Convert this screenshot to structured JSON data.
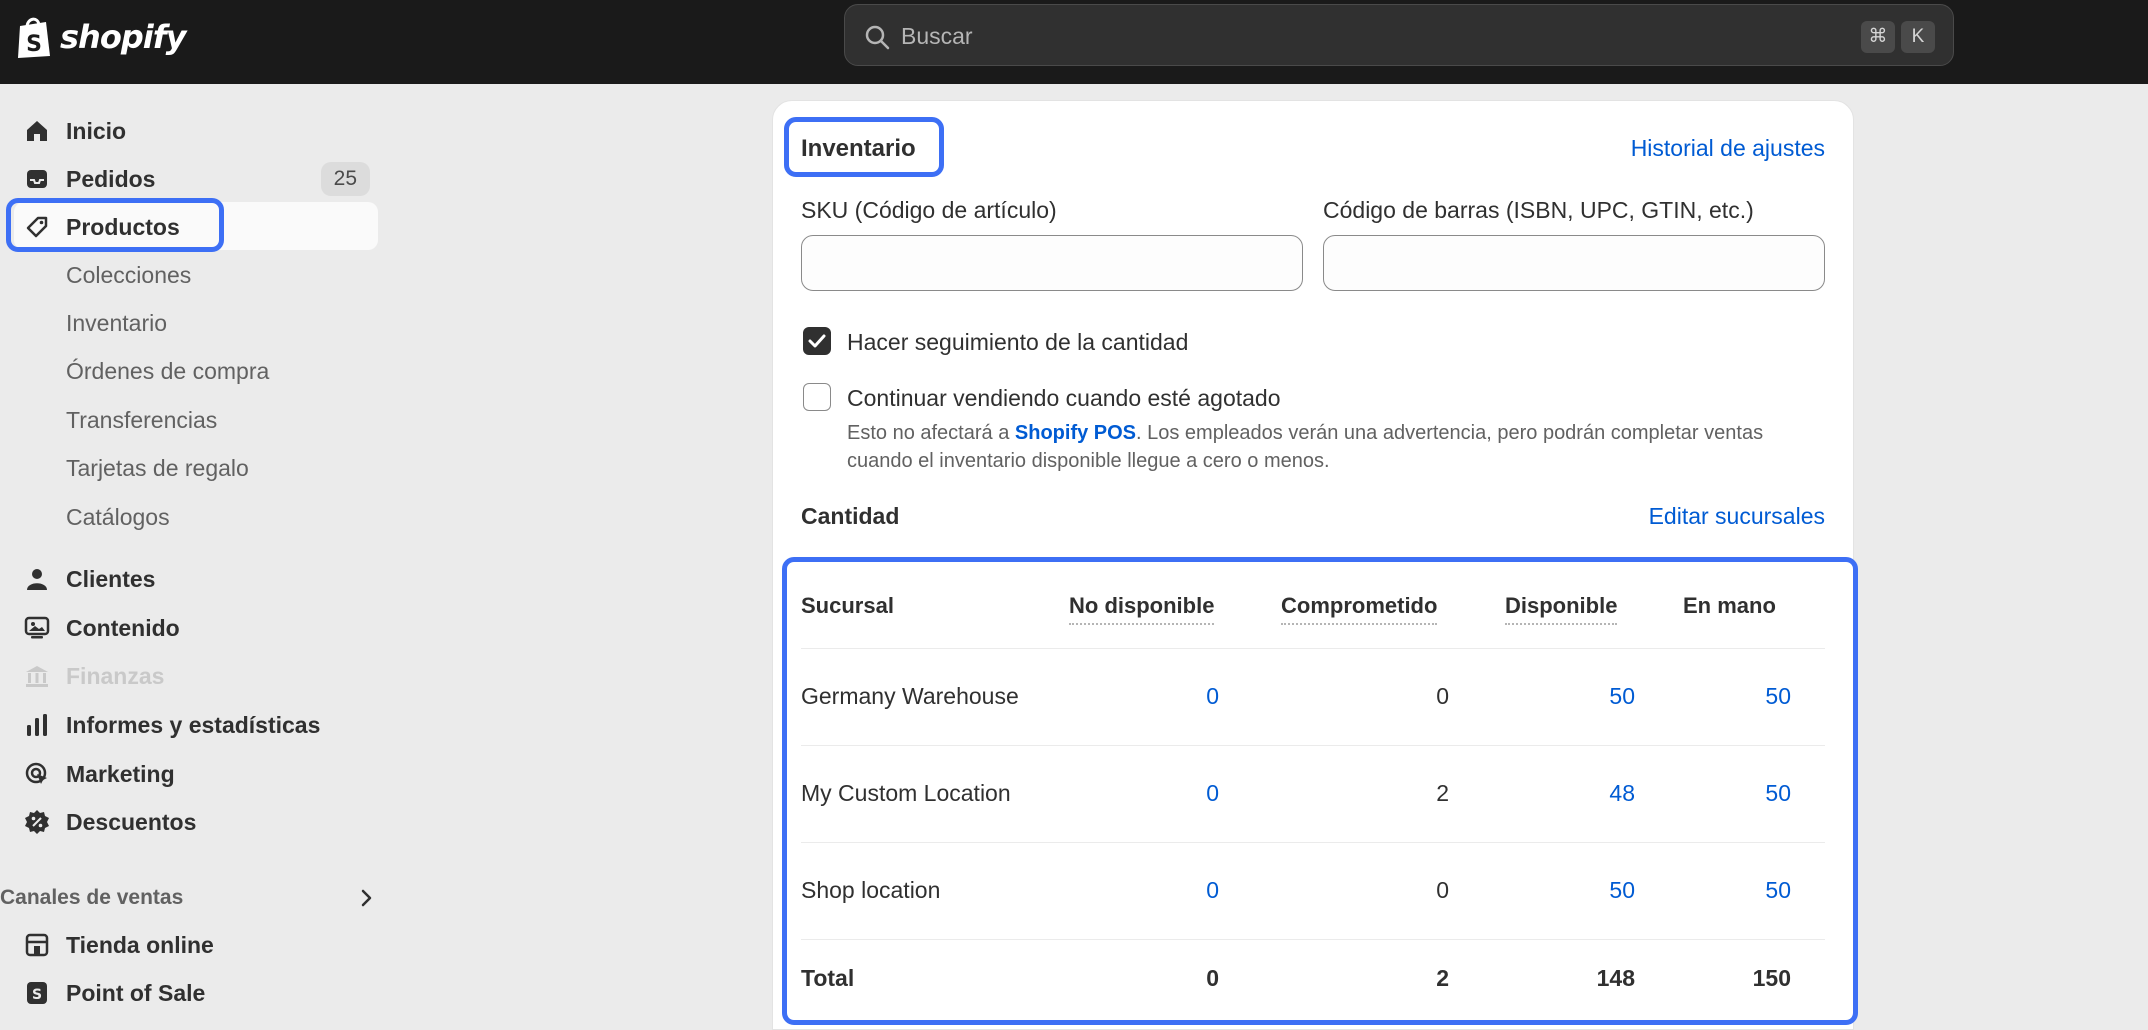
{
  "app": {
    "brand": "shopify"
  },
  "search": {
    "placeholder": "Buscar",
    "shortcut_keys": [
      "⌘",
      "K"
    ]
  },
  "sidebar": {
    "items": [
      {
        "label": "Inicio",
        "icon": "home-icon"
      },
      {
        "label": "Pedidos",
        "icon": "inbox-icon",
        "badge": "25"
      },
      {
        "label": "Productos",
        "icon": "tag-icon",
        "active": true
      },
      {
        "label": "Colecciones",
        "sub": true
      },
      {
        "label": "Inventario",
        "sub": true
      },
      {
        "label": "Órdenes de compra",
        "sub": true
      },
      {
        "label": "Transferencias",
        "sub": true
      },
      {
        "label": "Tarjetas de regalo",
        "sub": true
      },
      {
        "label": "Catálogos",
        "sub": true
      },
      {
        "label": "Clientes",
        "icon": "person-icon"
      },
      {
        "label": "Contenido",
        "icon": "content-icon"
      },
      {
        "label": "Finanzas",
        "icon": "bank-icon",
        "disabled": true
      },
      {
        "label": "Informes y estadísticas",
        "icon": "bar-chart-icon"
      },
      {
        "label": "Marketing",
        "icon": "target-icon"
      },
      {
        "label": "Descuentos",
        "icon": "discount-icon"
      }
    ],
    "sales_channels_label": "Canales de ventas",
    "channels": [
      {
        "label": "Tienda online",
        "icon": "store-icon"
      },
      {
        "label": "Point of Sale",
        "icon": "pos-icon"
      }
    ]
  },
  "inventory": {
    "title": "Inventario",
    "history_link": "Historial de ajustes",
    "sku_label": "SKU (Código de artículo)",
    "sku_value": "",
    "barcode_label": "Código de barras (ISBN, UPC, GTIN, etc.)",
    "barcode_value": "",
    "track_quantity_label": "Hacer seguimiento de la cantidad",
    "track_quantity_checked": true,
    "continue_selling_label": "Continuar vendiendo cuando esté agotado",
    "continue_selling_checked": false,
    "help_before": "Esto no afectará a ",
    "help_link": "Shopify POS",
    "help_after": ". Los empleados verán una advertencia, pero podrán completar ventas cuando el inventario disponible llegue a cero o menos.",
    "quantity_title": "Cantidad",
    "edit_locations_link": "Editar sucursales"
  },
  "table": {
    "headers": {
      "location": "Sucursal",
      "unavailable": "No disponible",
      "committed": "Comprometido",
      "available": "Disponible",
      "on_hand": "En mano"
    },
    "rows": [
      {
        "location": "Germany Warehouse",
        "unavailable": "0",
        "committed": "0",
        "available": "50",
        "on_hand": "50"
      },
      {
        "location": "My Custom Location",
        "unavailable": "0",
        "committed": "2",
        "available": "48",
        "on_hand": "50"
      },
      {
        "location": "Shop location",
        "unavailable": "0",
        "committed": "0",
        "available": "50",
        "on_hand": "50"
      }
    ],
    "total": {
      "location": "Total",
      "unavailable": "0",
      "committed": "2",
      "available": "148",
      "on_hand": "150"
    }
  },
  "colors": {
    "accent": "#3d6ff5",
    "link": "#005bd3",
    "topbar": "#1a1a1a"
  }
}
